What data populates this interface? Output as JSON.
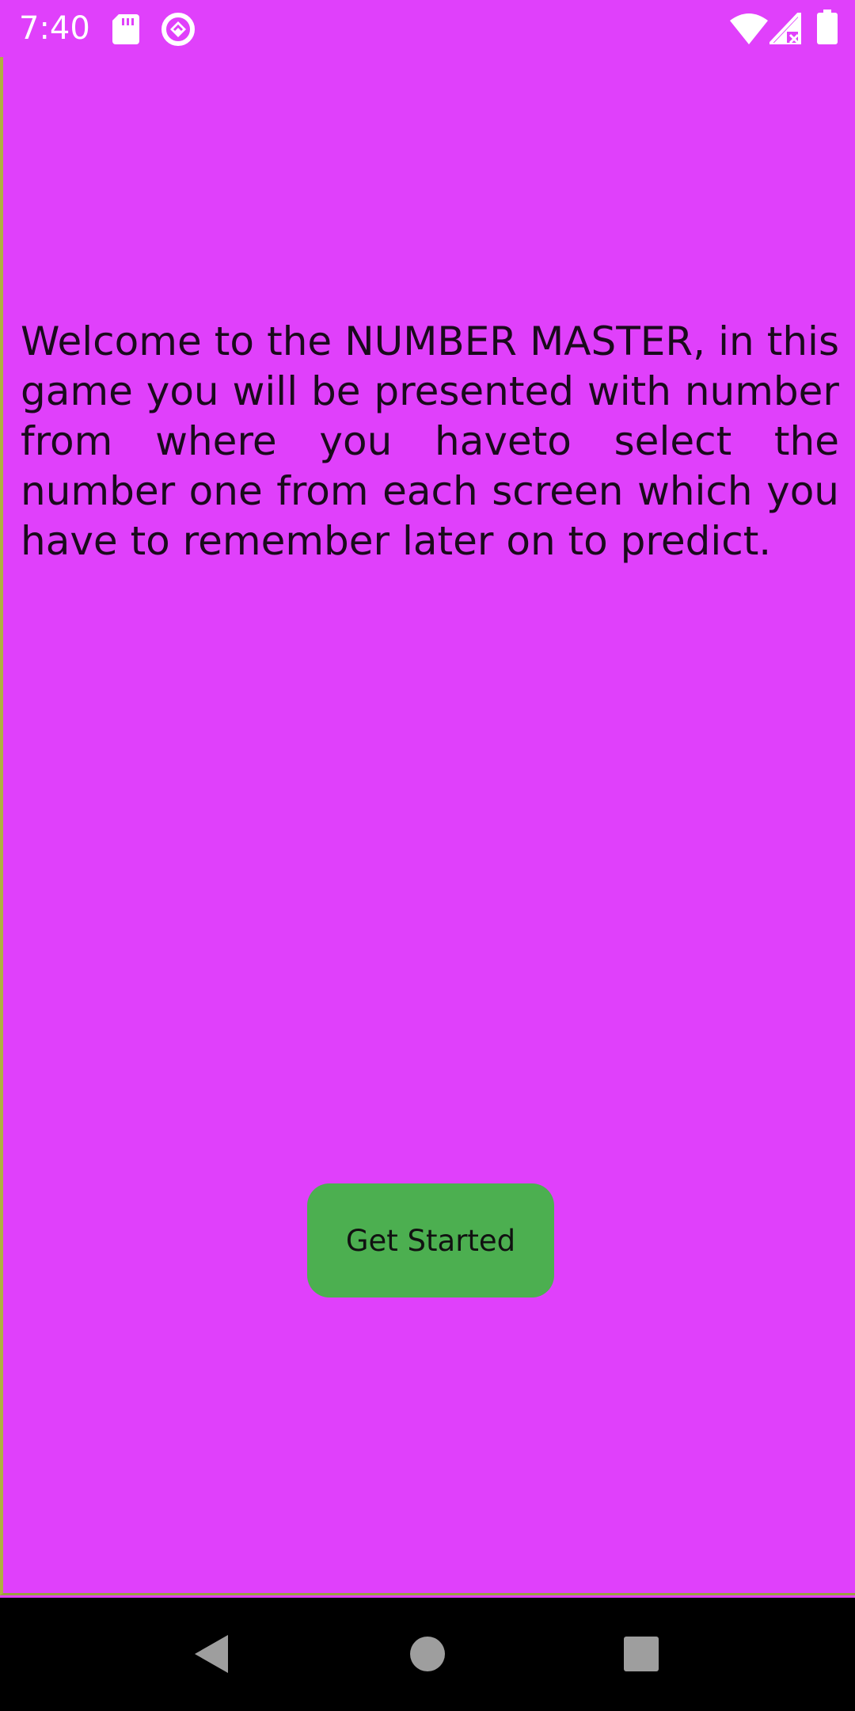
{
  "status_bar": {
    "time": "7:40",
    "icons": [
      "sd-card-icon",
      "sync-icon",
      "wifi-icon",
      "signal-no-data-icon",
      "battery-icon"
    ]
  },
  "main": {
    "welcome_text": "Welcome to the NUMBER MASTER, in this game you will be presented with number from where you haveto select the number one from each screen which you have to remember later on to predict.",
    "start_button_label": "Get Started"
  },
  "nav_bar": {
    "buttons": [
      "back-icon",
      "home-icon",
      "recents-icon"
    ]
  },
  "colors": {
    "background": "#e040fb",
    "button": "#4caf50",
    "nav_bar": "#000000"
  }
}
